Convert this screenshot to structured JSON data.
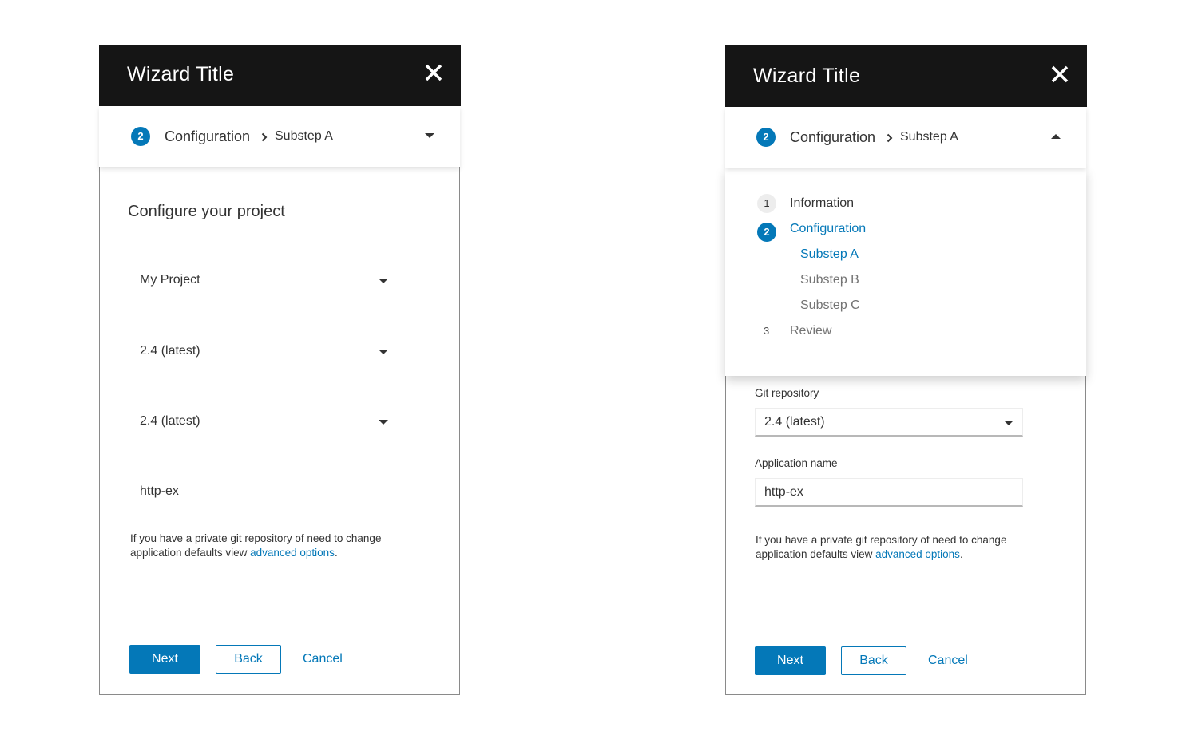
{
  "colors": {
    "accent": "#0478b8",
    "header_bg": "#151515"
  },
  "left": {
    "title": "Wizard Title",
    "close_icon": "close-icon",
    "nav": {
      "step_number": "2",
      "step": "Configuration",
      "substep": "Substep A",
      "toggle_icon": "caret-down-icon"
    },
    "heading": "Configure your project",
    "fields": [
      {
        "value": "My Project"
      },
      {
        "value": "2.4 (latest)"
      },
      {
        "value": "2.4 (latest)"
      },
      {
        "value": "http-ex"
      }
    ],
    "help_text": "If you have a private git repository of need to change application defaults view ",
    "help_link": "advanced options",
    "help_end": ".",
    "next": "Next",
    "back": "Back",
    "cancel": "Cancel"
  },
  "right": {
    "title": "Wizard Title",
    "close_icon": "close-icon",
    "nav": {
      "step_number": "2",
      "step": "Configuration",
      "substep": "Substep A",
      "toggle_icon": "caret-up-icon"
    },
    "menu": [
      {
        "number": "1",
        "label": "Information",
        "state": "complete"
      },
      {
        "number": "2",
        "label": "Configuration",
        "state": "current"
      },
      {
        "label": "Substep A",
        "state": "current"
      },
      {
        "label": "Substep B",
        "state": "pending"
      },
      {
        "label": "Substep C",
        "state": "pending"
      },
      {
        "number": "3",
        "label": "Review",
        "state": "pending"
      }
    ],
    "git_label": "Git repository",
    "git_value": "2.4 (latest)",
    "app_label": "Application name",
    "app_value": "http-ex",
    "help_text": "If you have a private git repository of need to change application defaults view ",
    "help_link": "advanced options",
    "help_end": ".",
    "next": "Next",
    "back": "Back",
    "cancel": "Cancel"
  }
}
